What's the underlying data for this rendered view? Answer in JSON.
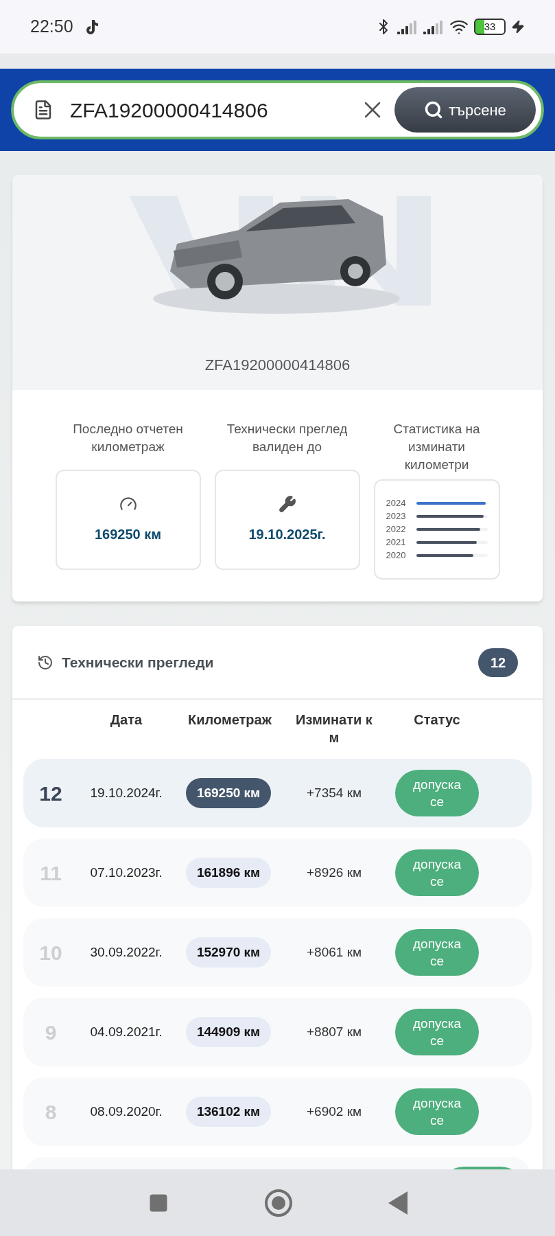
{
  "status_bar": {
    "time": "22:50",
    "battery": "33"
  },
  "search": {
    "value": "ZFA19200000414806",
    "button": "търсене"
  },
  "vehicle": {
    "vin": "ZFA19200000414806"
  },
  "stats": [
    {
      "kind": "mileage",
      "label": "Последно отчетен километраж",
      "value": "169250 км"
    },
    {
      "kind": "inspection",
      "label": "Технически преглед валиден до",
      "value": "19.10.2025г."
    },
    {
      "kind": "chart",
      "label": "Статистика на изминати километри",
      "bars": [
        {
          "year": "2024",
          "level": 0.98,
          "highlighted": true
        },
        {
          "year": "2023",
          "level": 0.95,
          "highlighted": false
        },
        {
          "year": "2022",
          "level": 0.9,
          "highlighted": false
        },
        {
          "year": "2021",
          "level": 0.85,
          "highlighted": false
        },
        {
          "year": "2020",
          "level": 0.8,
          "highlighted": false
        }
      ]
    }
  ],
  "inspections": {
    "title": "Технически прегледи",
    "count": "12",
    "columns": [
      "Дата",
      "Километраж",
      "Изминати к м",
      "Статус"
    ],
    "rows": [
      {
        "number": "12",
        "date": "19.10.2024г.",
        "mileage": "169250 км",
        "diff": "+7354 км",
        "status": "допуска се",
        "selected": true
      },
      {
        "number": "11",
        "date": "07.10.2023г.",
        "mileage": "161896 км",
        "diff": "+8926 км",
        "status": "допуска се",
        "selected": false
      },
      {
        "number": "10",
        "date": "30.09.2022г.",
        "mileage": "152970 км",
        "diff": "+8061 км",
        "status": "допуска се",
        "selected": false
      },
      {
        "number": "9",
        "date": "04.09.2021г.",
        "mileage": "144909 км",
        "diff": "+8807 км",
        "status": "допуска се",
        "selected": false
      },
      {
        "number": "8",
        "date": "08.09.2020г.",
        "mileage": "136102 км",
        "diff": "+6902 км",
        "status": "допуска се",
        "selected": false
      }
    ]
  }
}
